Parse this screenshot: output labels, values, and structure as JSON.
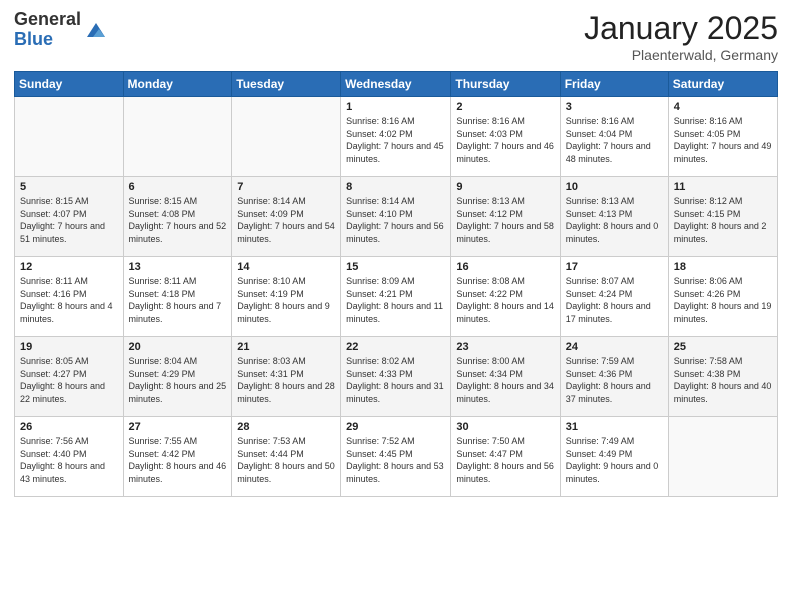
{
  "logo": {
    "general": "General",
    "blue": "Blue"
  },
  "header": {
    "month": "January 2025",
    "location": "Plaenterwald, Germany"
  },
  "weekdays": [
    "Sunday",
    "Monday",
    "Tuesday",
    "Wednesday",
    "Thursday",
    "Friday",
    "Saturday"
  ],
  "weeks": [
    [
      {
        "day": "",
        "info": ""
      },
      {
        "day": "",
        "info": ""
      },
      {
        "day": "",
        "info": ""
      },
      {
        "day": "1",
        "info": "Sunrise: 8:16 AM\nSunset: 4:02 PM\nDaylight: 7 hours and 45 minutes."
      },
      {
        "day": "2",
        "info": "Sunrise: 8:16 AM\nSunset: 4:03 PM\nDaylight: 7 hours and 46 minutes."
      },
      {
        "day": "3",
        "info": "Sunrise: 8:16 AM\nSunset: 4:04 PM\nDaylight: 7 hours and 48 minutes."
      },
      {
        "day": "4",
        "info": "Sunrise: 8:16 AM\nSunset: 4:05 PM\nDaylight: 7 hours and 49 minutes."
      }
    ],
    [
      {
        "day": "5",
        "info": "Sunrise: 8:15 AM\nSunset: 4:07 PM\nDaylight: 7 hours and 51 minutes."
      },
      {
        "day": "6",
        "info": "Sunrise: 8:15 AM\nSunset: 4:08 PM\nDaylight: 7 hours and 52 minutes."
      },
      {
        "day": "7",
        "info": "Sunrise: 8:14 AM\nSunset: 4:09 PM\nDaylight: 7 hours and 54 minutes."
      },
      {
        "day": "8",
        "info": "Sunrise: 8:14 AM\nSunset: 4:10 PM\nDaylight: 7 hours and 56 minutes."
      },
      {
        "day": "9",
        "info": "Sunrise: 8:13 AM\nSunset: 4:12 PM\nDaylight: 7 hours and 58 minutes."
      },
      {
        "day": "10",
        "info": "Sunrise: 8:13 AM\nSunset: 4:13 PM\nDaylight: 8 hours and 0 minutes."
      },
      {
        "day": "11",
        "info": "Sunrise: 8:12 AM\nSunset: 4:15 PM\nDaylight: 8 hours and 2 minutes."
      }
    ],
    [
      {
        "day": "12",
        "info": "Sunrise: 8:11 AM\nSunset: 4:16 PM\nDaylight: 8 hours and 4 minutes."
      },
      {
        "day": "13",
        "info": "Sunrise: 8:11 AM\nSunset: 4:18 PM\nDaylight: 8 hours and 7 minutes."
      },
      {
        "day": "14",
        "info": "Sunrise: 8:10 AM\nSunset: 4:19 PM\nDaylight: 8 hours and 9 minutes."
      },
      {
        "day": "15",
        "info": "Sunrise: 8:09 AM\nSunset: 4:21 PM\nDaylight: 8 hours and 11 minutes."
      },
      {
        "day": "16",
        "info": "Sunrise: 8:08 AM\nSunset: 4:22 PM\nDaylight: 8 hours and 14 minutes."
      },
      {
        "day": "17",
        "info": "Sunrise: 8:07 AM\nSunset: 4:24 PM\nDaylight: 8 hours and 17 minutes."
      },
      {
        "day": "18",
        "info": "Sunrise: 8:06 AM\nSunset: 4:26 PM\nDaylight: 8 hours and 19 minutes."
      }
    ],
    [
      {
        "day": "19",
        "info": "Sunrise: 8:05 AM\nSunset: 4:27 PM\nDaylight: 8 hours and 22 minutes."
      },
      {
        "day": "20",
        "info": "Sunrise: 8:04 AM\nSunset: 4:29 PM\nDaylight: 8 hours and 25 minutes."
      },
      {
        "day": "21",
        "info": "Sunrise: 8:03 AM\nSunset: 4:31 PM\nDaylight: 8 hours and 28 minutes."
      },
      {
        "day": "22",
        "info": "Sunrise: 8:02 AM\nSunset: 4:33 PM\nDaylight: 8 hours and 31 minutes."
      },
      {
        "day": "23",
        "info": "Sunrise: 8:00 AM\nSunset: 4:34 PM\nDaylight: 8 hours and 34 minutes."
      },
      {
        "day": "24",
        "info": "Sunrise: 7:59 AM\nSunset: 4:36 PM\nDaylight: 8 hours and 37 minutes."
      },
      {
        "day": "25",
        "info": "Sunrise: 7:58 AM\nSunset: 4:38 PM\nDaylight: 8 hours and 40 minutes."
      }
    ],
    [
      {
        "day": "26",
        "info": "Sunrise: 7:56 AM\nSunset: 4:40 PM\nDaylight: 8 hours and 43 minutes."
      },
      {
        "day": "27",
        "info": "Sunrise: 7:55 AM\nSunset: 4:42 PM\nDaylight: 8 hours and 46 minutes."
      },
      {
        "day": "28",
        "info": "Sunrise: 7:53 AM\nSunset: 4:44 PM\nDaylight: 8 hours and 50 minutes."
      },
      {
        "day": "29",
        "info": "Sunrise: 7:52 AM\nSunset: 4:45 PM\nDaylight: 8 hours and 53 minutes."
      },
      {
        "day": "30",
        "info": "Sunrise: 7:50 AM\nSunset: 4:47 PM\nDaylight: 8 hours and 56 minutes."
      },
      {
        "day": "31",
        "info": "Sunrise: 7:49 AM\nSunset: 4:49 PM\nDaylight: 9 hours and 0 minutes."
      },
      {
        "day": "",
        "info": ""
      }
    ]
  ]
}
